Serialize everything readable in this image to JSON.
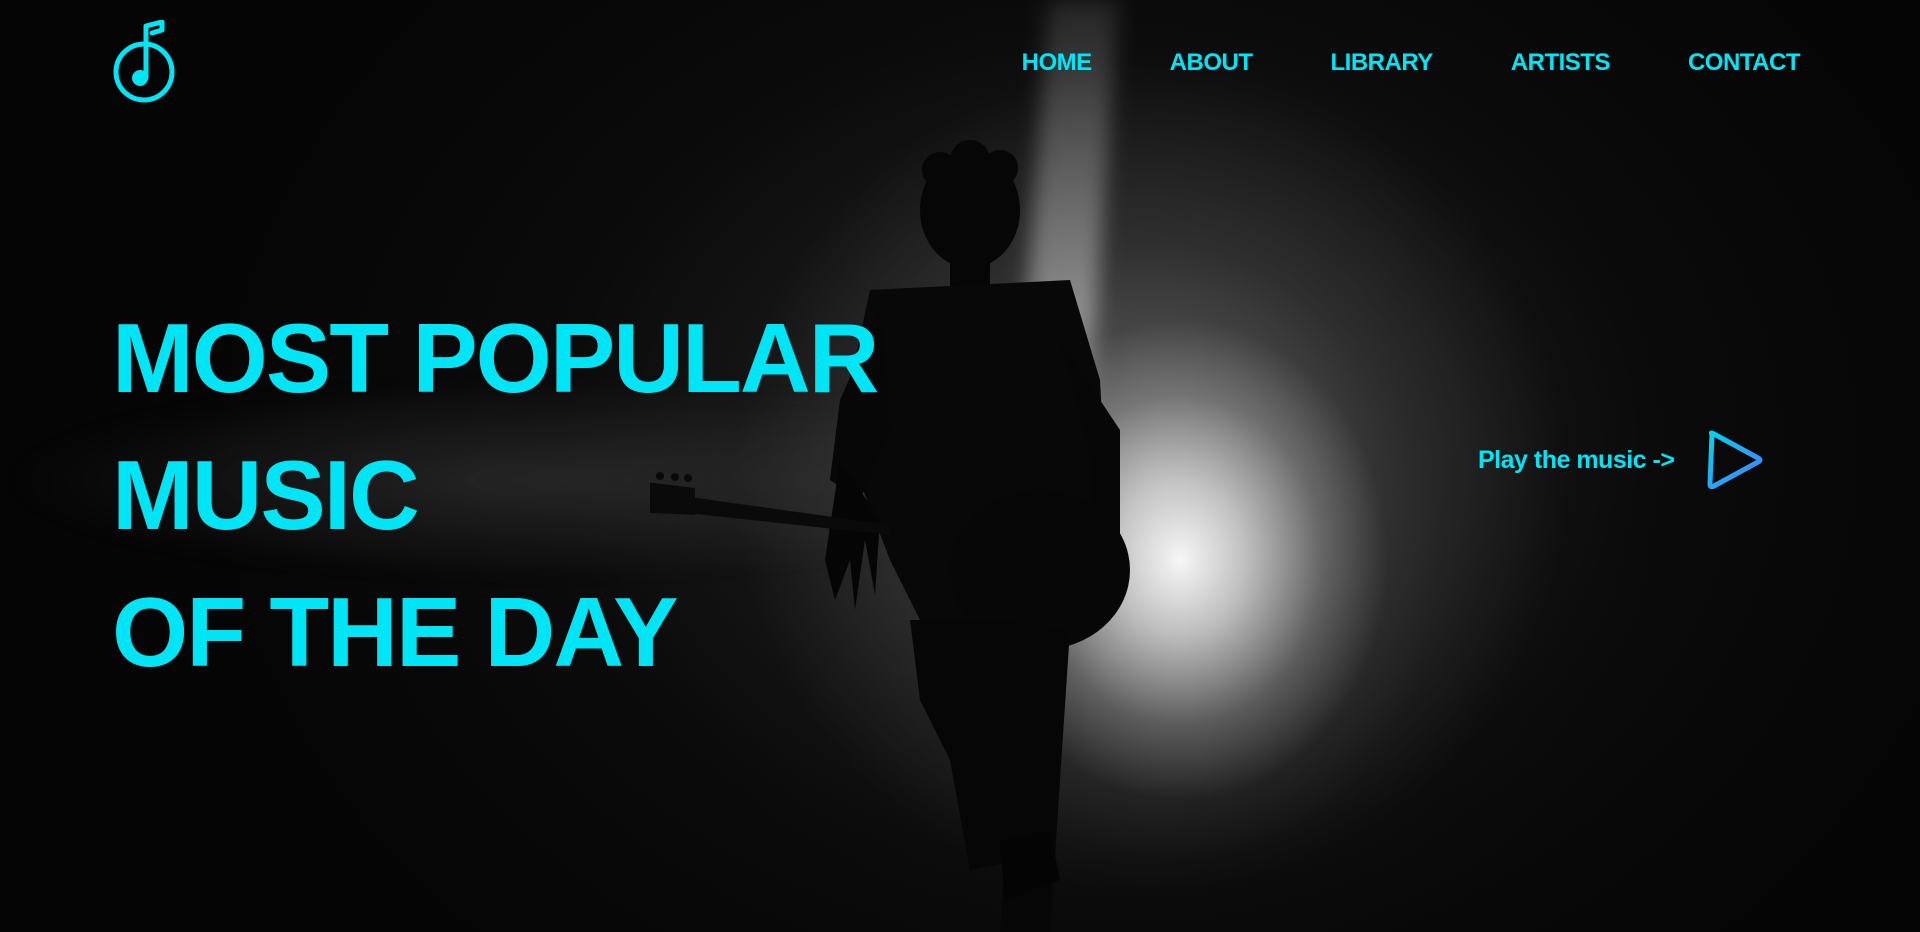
{
  "logo": {
    "icon": "music-note-circle-icon",
    "color": "#00e5f5"
  },
  "nav": {
    "items": [
      {
        "label": "HOME"
      },
      {
        "label": "ABOUT"
      },
      {
        "label": "LIBRARY"
      },
      {
        "label": "ARTISTS"
      },
      {
        "label": "CONTACT"
      }
    ]
  },
  "hero": {
    "headline_lines": [
      "MOST POPULAR",
      "MUSIC",
      "OF THE DAY"
    ],
    "play_text": "Play the music ->",
    "play_icon": "play-icon"
  },
  "colors": {
    "accent": "#00e5f5",
    "play_gradient_start": "#00d4f0",
    "play_gradient_end": "#4a7bff",
    "background": "#050505"
  }
}
